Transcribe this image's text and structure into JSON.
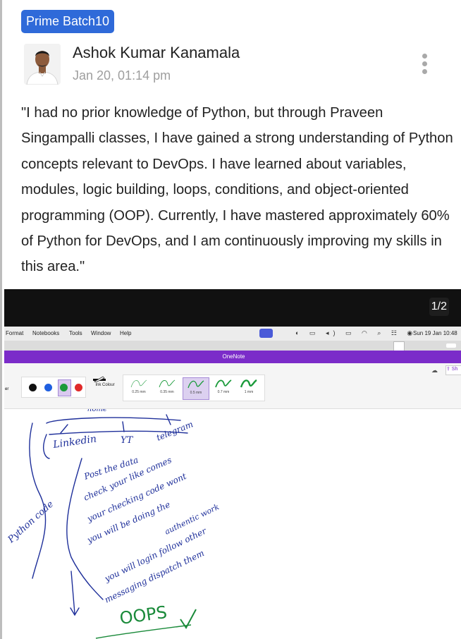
{
  "badge": "Prime Batch10",
  "author": {
    "name": "Ashok Kumar Kanamala",
    "date": "Jan 20, 01:14 pm"
  },
  "review": "\"I had no prior knowledge of Python, but through Praveen Singampalli classes, I have gained a strong understanding of Python concepts relevant to DevOps. I have learned about variables, modules, logic building, loops, conditions, and object-oriented programming (OOP). Currently, I have mastered approximately 60% of Python for DevOps, and I am continuously improving my skills in this area.\"",
  "media": {
    "counter": "1/2",
    "menubar": {
      "items": [
        "Format",
        "Notebooks",
        "Tools",
        "Window",
        "Help"
      ],
      "clock": "Sun 19 Jan 10:48"
    },
    "window_title": "OneNote",
    "ink_label": "Ink Colour",
    "edge_label": "er",
    "pen_colors": [
      "#111111",
      "#1f5fe0",
      "#1a9a3a",
      "#e02a2a"
    ],
    "thickness_options": [
      "0.25 mm",
      "0.35 mm",
      "0.5 mm",
      "0.7 mm",
      "1 mm"
    ],
    "selected_thickness": "0.5 mm",
    "handwriting": {
      "home": "home",
      "linkedin": "Linkedin",
      "yt": "YT",
      "telegram": "telegram",
      "python_code": "Python code",
      "line1": "Post the data",
      "line2": "check your like comes",
      "line3": "your checking code wont",
      "line4": "you will be doing the",
      "line5": "authentic work",
      "line6": "you will login follow other",
      "line7": "messaging dispatch them",
      "oops": "OOPS"
    }
  }
}
